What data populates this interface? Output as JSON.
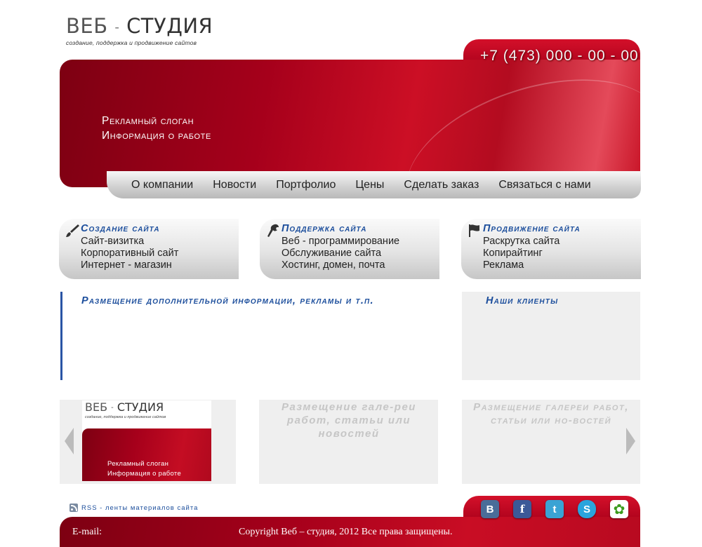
{
  "logo": {
    "title_part1": "ВЕБ",
    "title_dash": "-",
    "title_part2": "СТУДИЯ",
    "subtitle": "создание, поддержка и продвижение сайтов"
  },
  "header": {
    "phone": "+7 (473) 000 - 00 - 00",
    "slogan_line1": "Рекламный слоган",
    "slogan_line2": "Информация о работе"
  },
  "nav": {
    "items": [
      {
        "label": "О компании"
      },
      {
        "label": "Новости"
      },
      {
        "label": "Портфолио"
      },
      {
        "label": "Цены"
      },
      {
        "label": "Сделать заказ"
      },
      {
        "label": "Связаться с нами"
      }
    ]
  },
  "services": [
    {
      "title": "Создание сайта",
      "icon": "brush-icon",
      "items": [
        "Сайт-визитка",
        "Корпоративный сайт",
        "Интернет - магазин"
      ]
    },
    {
      "title": "Поддержка сайта",
      "icon": "wrench-icon",
      "items": [
        "Веб - программирование",
        "Обслуживание сайта",
        "Хостинг, домен, почта"
      ]
    },
    {
      "title": "Продвижение сайта",
      "icon": "flag-icon",
      "items": [
        "Раскрутка сайта",
        "Копирайтинг",
        "Реклама"
      ]
    }
  ],
  "info": {
    "title": "Размещение дополнительной информации, рекламы и т.п."
  },
  "clients": {
    "title": "Наши клиенты"
  },
  "gallery": {
    "thumb": {
      "title_part1": "ВЕБ",
      "title_dash": "-",
      "title_part2": "СТУДИЯ",
      "subtitle": "создание, поддержка и продвижение сайтов",
      "slogan_line1": "Рекламный слоган",
      "slogan_line2": "Информация о работе"
    },
    "box2_text": "Размещение гале-реи работ, статьи или новостей",
    "box3_text": "Размещение галереи работ, статьи или но-востей",
    "prev_icon": "chevron-left-icon",
    "next_icon": "chevron-right-icon"
  },
  "footer": {
    "rss_label": "RSS - ленты материалов сайта",
    "email_label": "E-mail:",
    "copyright": "Copyright Веб – студия, 2012 Все права защищены.",
    "socials": [
      {
        "name": "vkontakte-icon",
        "glyph": "B"
      },
      {
        "name": "facebook-icon",
        "glyph": "f"
      },
      {
        "name": "twitter-icon",
        "glyph": "t"
      },
      {
        "name": "skype-icon",
        "glyph": "S"
      },
      {
        "name": "icq-icon",
        "glyph": "✿"
      }
    ]
  },
  "colors": {
    "brand_red": "#b0001c",
    "link_blue": "#1c4e9c",
    "nav_gray": "#cfcfcf"
  }
}
